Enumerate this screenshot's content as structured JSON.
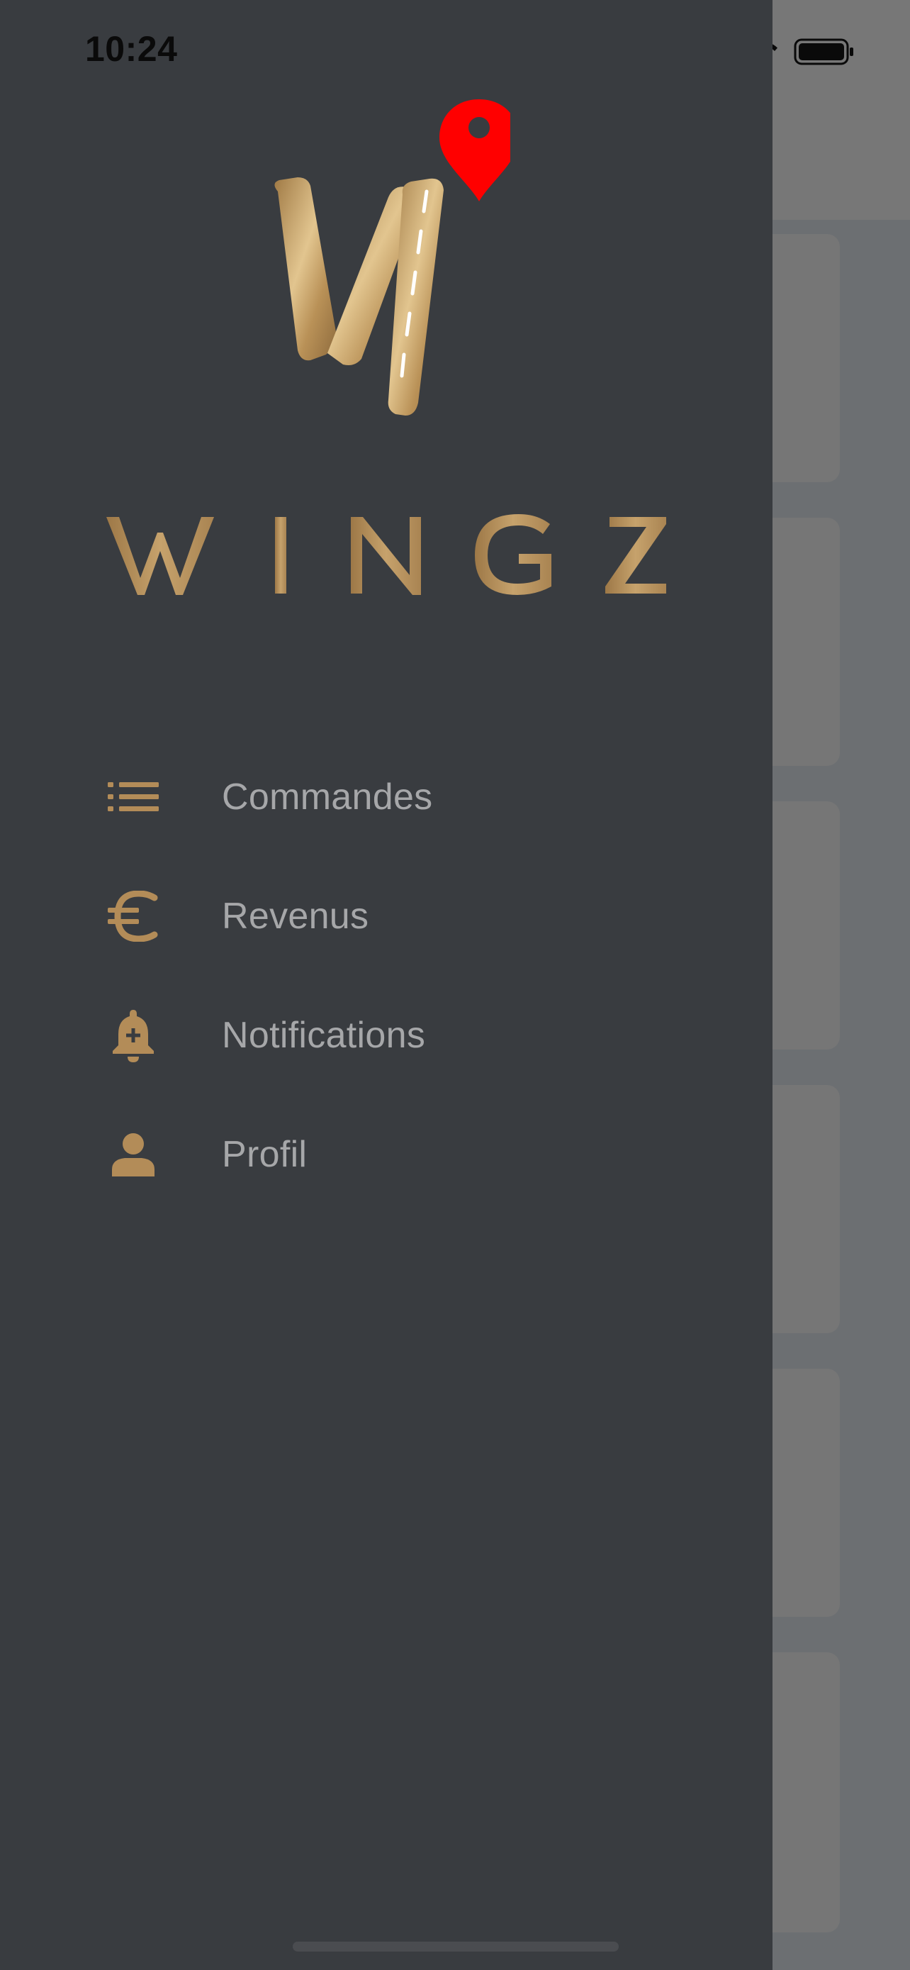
{
  "status_bar": {
    "time": "10:24"
  },
  "brand": {
    "wordmark": "WINGZ",
    "gold_color": "#b38c58",
    "pin_color": "#ff0000"
  },
  "menu": {
    "items": [
      {
        "label": "Commandes",
        "icon": "list-icon"
      },
      {
        "label": "Revenus",
        "icon": "euro-icon"
      },
      {
        "label": "Notifications",
        "icon": "bell-plus-icon"
      },
      {
        "label": "Profil",
        "icon": "person-icon"
      }
    ]
  }
}
